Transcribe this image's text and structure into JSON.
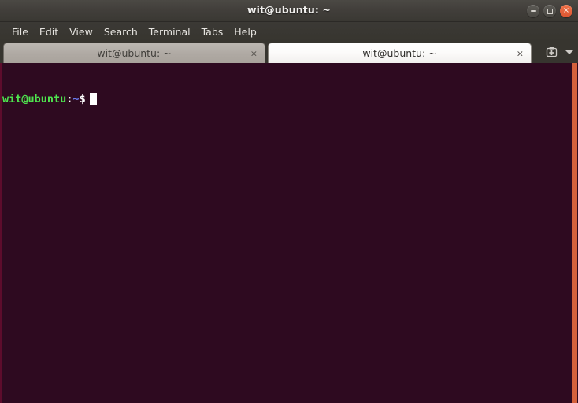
{
  "window": {
    "title": "wit@ubuntu: ~",
    "controls": [
      {
        "name": "minimize",
        "label": "–"
      },
      {
        "name": "maximize",
        "label": "□"
      },
      {
        "name": "close",
        "label": "×"
      }
    ]
  },
  "menubar": {
    "items": [
      {
        "label": "File"
      },
      {
        "label": "Edit"
      },
      {
        "label": "View"
      },
      {
        "label": "Search"
      },
      {
        "label": "Terminal"
      },
      {
        "label": "Tabs"
      },
      {
        "label": "Help"
      }
    ]
  },
  "tabs": {
    "items": [
      {
        "label": "wit@ubuntu: ~",
        "close_label": "×",
        "active": false
      },
      {
        "label": "wit@ubuntu: ~",
        "close_label": "×",
        "active": true
      }
    ],
    "new_tab_label": "+",
    "tab_list_chevron": "▾"
  },
  "terminal": {
    "prompt_user_host": "wit@ubuntu",
    "prompt_colon": ":",
    "prompt_path": "~",
    "prompt_dollar": "$",
    "command": "",
    "cursor": "block"
  },
  "colors": {
    "terminal_background": "#2e0a20",
    "prompt_user_host": "#4ee44e",
    "prompt_path": "#6a7bf0",
    "prompt_text": "#ffffff",
    "titlebar": "#3f3d39",
    "tab_active": "#ffffff",
    "tab_inactive": "#afa9a3",
    "close_button": "#dc5430",
    "scrollbar": "#d4613c"
  }
}
